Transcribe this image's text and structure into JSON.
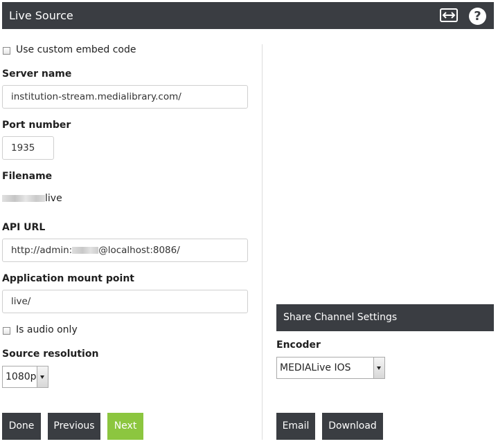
{
  "header": {
    "title": "Live Source",
    "expand_icon": "expand-horizontal-icon",
    "help_icon": "help-circle-icon",
    "help_glyph": "?"
  },
  "form": {
    "custom_embed_label": "Use custom embed code",
    "custom_embed_checked": false,
    "server_name_label": "Server name",
    "server_name_value": "institution-stream.medialibrary.com/",
    "port_label": "Port number",
    "port_value": "1935",
    "filename_label": "Filename",
    "filename_suffix": "live",
    "api_url_label": "API URL",
    "api_url_prefix": "http://admin:",
    "api_url_suffix": "@localhost:8086/",
    "mount_label": "Application mount point",
    "mount_value": "live/",
    "audio_only_label": "Is audio only",
    "audio_only_checked": false,
    "resolution_label": "Source resolution",
    "resolution_value": "1080p"
  },
  "buttons": {
    "done": "Done",
    "previous": "Previous",
    "next": "Next",
    "email": "Email",
    "download": "Download"
  },
  "share": {
    "title": "Share Channel Settings",
    "encoder_label": "Encoder",
    "encoder_value": "MEDIALive IOS"
  },
  "colors": {
    "header_bg": "#3a3d42",
    "next_green": "#8cc63f"
  }
}
